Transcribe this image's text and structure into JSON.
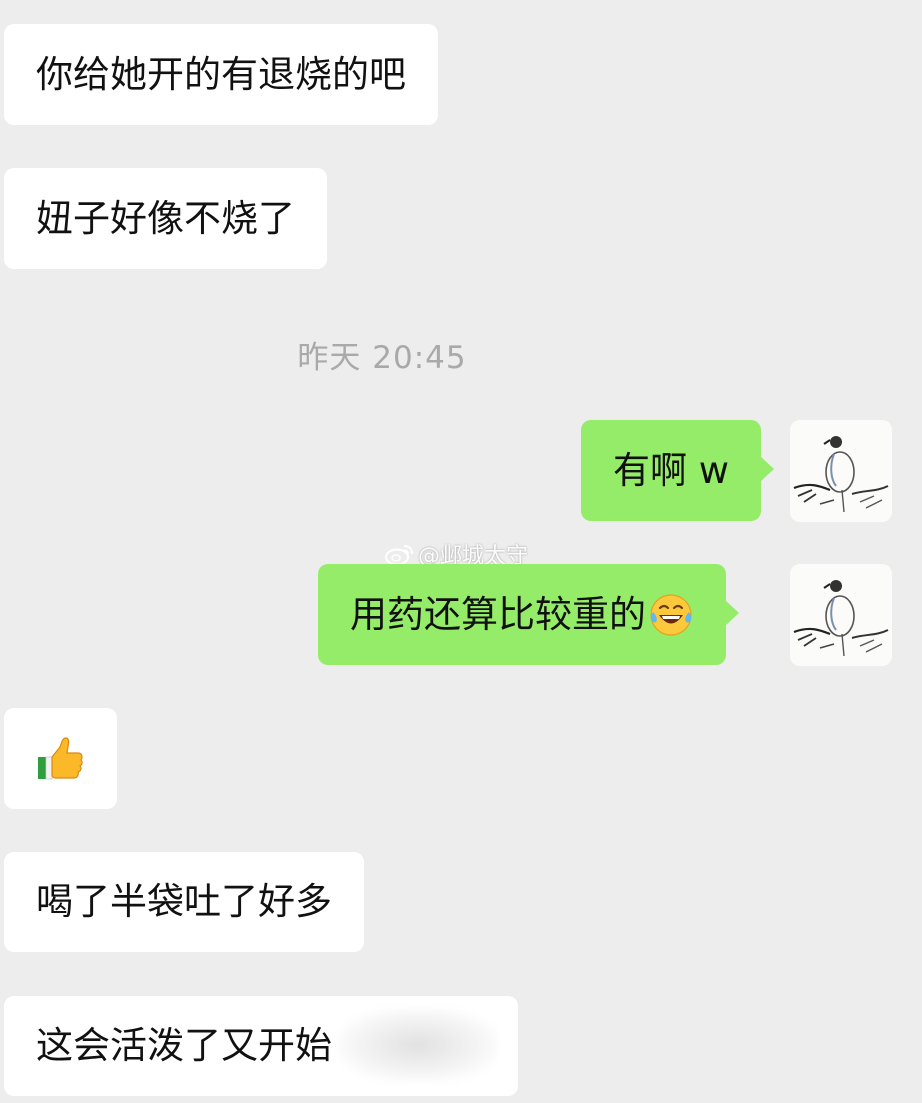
{
  "messages": [
    {
      "id": "m1",
      "side": "incoming",
      "text": "你给她开的有退烧的吧"
    },
    {
      "id": "m2",
      "side": "incoming",
      "text": "妞子好像不烧了"
    },
    {
      "id": "m3",
      "side": "outgoing",
      "text": "有啊 w"
    },
    {
      "id": "m4",
      "side": "outgoing",
      "text": "用药还算比较重的",
      "emoji": "laugh-cry-emoji"
    },
    {
      "id": "m5",
      "side": "incoming",
      "emoji": "thumbs-up-emoji"
    },
    {
      "id": "m6",
      "side": "incoming",
      "text": "喝了半袋吐了好多"
    },
    {
      "id": "m7",
      "side": "incoming",
      "text": "这会活泼了又开始",
      "blurred": true
    }
  ],
  "timestamp": "昨天 20:45",
  "watermark": {
    "icon": "weibo-icon",
    "text": "@邺城太守"
  },
  "colors": {
    "background": "#ededed",
    "incoming_bubble": "#ffffff",
    "outgoing_bubble": "#95ec69",
    "timestamp_text": "#a9a9a9"
  }
}
